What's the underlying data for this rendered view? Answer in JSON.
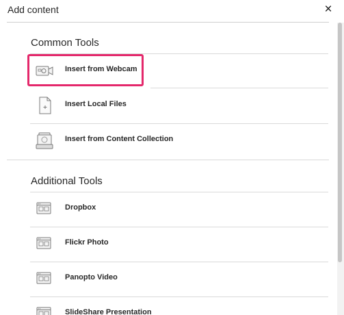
{
  "header": {
    "title": "Add content",
    "close_glyph": "×"
  },
  "sections": [
    {
      "title": "Common Tools"
    },
    {
      "title": "Additional Tools"
    }
  ],
  "common_items": [
    {
      "label": "Insert from Webcam",
      "icon": "webcam-icon",
      "highlighted": true
    },
    {
      "label": "Insert Local Files",
      "icon": "file-icon"
    },
    {
      "label": "Insert from Content Collection",
      "icon": "content-collection-icon"
    }
  ],
  "additional_items": [
    {
      "label": "Dropbox",
      "icon": "tool-window-icon"
    },
    {
      "label": "Flickr Photo",
      "icon": "tool-window-icon"
    },
    {
      "label": "Panopto Video",
      "icon": "tool-window-icon"
    },
    {
      "label": "SlideShare Presentation",
      "icon": "tool-window-icon"
    }
  ],
  "colors": {
    "highlight": "#e4286b",
    "text": "#262626",
    "divider": "#d9d9d9"
  }
}
